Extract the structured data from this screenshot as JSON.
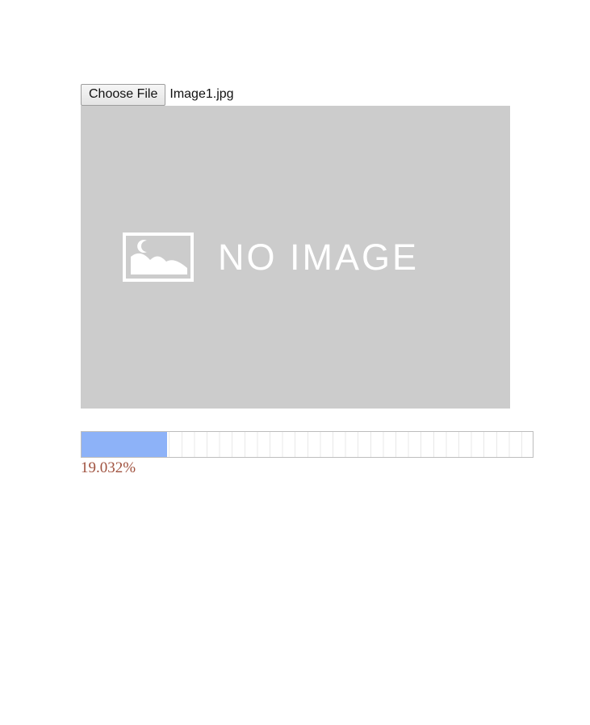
{
  "file_input": {
    "button_label": "Choose File",
    "file_name": "Image1.jpg"
  },
  "preview": {
    "placeholder_text": "NO IMAGE",
    "icon": "image-placeholder-icon"
  },
  "upload_progress": {
    "fraction": 0.19032,
    "percent_label": "19.032%"
  },
  "colors": {
    "preview_background": "#cccccc",
    "progress_fill": "#8db2f8",
    "progress_text": "#a0523f"
  }
}
